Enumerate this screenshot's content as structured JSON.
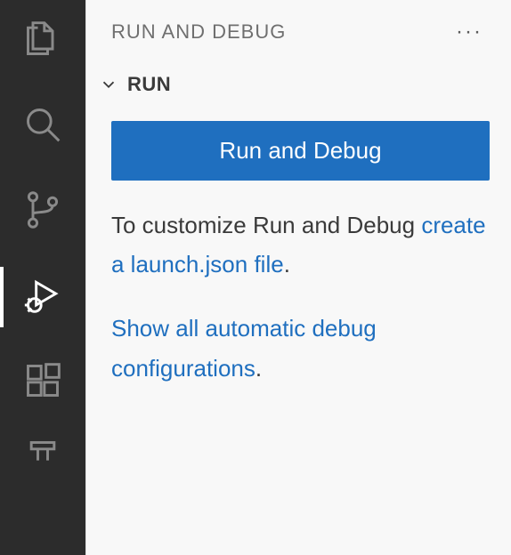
{
  "activityBar": {
    "explorer": "files-icon",
    "search": "search-icon",
    "sourceControl": "git-branch-icon",
    "runDebug": "debug-alt-icon",
    "extensions": "extensions-icon"
  },
  "sidebar": {
    "title": "RUN AND DEBUG",
    "moreLabel": "···",
    "section": {
      "label": "RUN"
    },
    "runButton": "Run and Debug",
    "customizeText1": "To customize Run and Debug ",
    "createLaunchLink": "create a launch.json file",
    "customizeText2": ".",
    "showAllLink": "Show all automatic debug configurations",
    "showAllText2": "."
  }
}
